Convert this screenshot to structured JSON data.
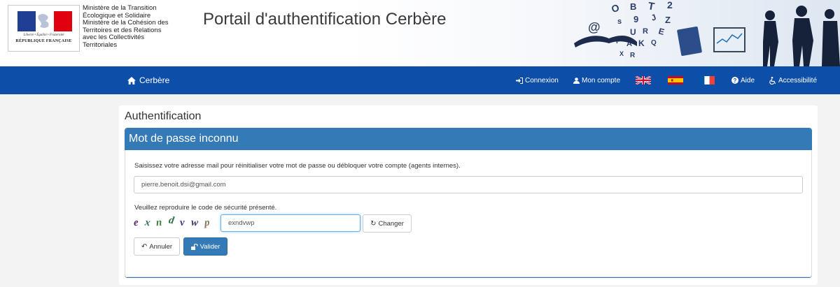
{
  "header": {
    "logo": {
      "motto": "Liberté • Égalité • Fraternité",
      "republic": "RÉPUBLIQUE FRANÇAISE",
      "colors": [
        "#1f3f94",
        "#ffffff",
        "#e1000f"
      ]
    },
    "ministry_lines": [
      "Ministère de la Transition",
      "Écologique et Solidaire",
      "Ministère de la Cohésion des",
      "Territoires et des Relations",
      "avec les Collectivités",
      "Territoriales"
    ],
    "portal_title": "Portail d'authentification Cerbère",
    "deco_letters": "B T 2 s 9 J U R O Z A E N K P Q X @ 8"
  },
  "navbar": {
    "background": "#0d4ea8",
    "brand": {
      "label": "Cerbère",
      "icon": "home-icon"
    },
    "items": [
      {
        "label": "Connexion",
        "icon": "sign-in-icon"
      },
      {
        "label": "Mon compte",
        "icon": "user-icon"
      },
      {
        "label": "Aide",
        "icon": "question-circle-icon"
      },
      {
        "label": "Accessibilité",
        "icon": "wheelchair-icon"
      }
    ],
    "flags": [
      "united-kingdom-flag",
      "spain-flag",
      "france-flag"
    ]
  },
  "main": {
    "card_title": "Authentification",
    "panel_title": "Mot de passe inconnu",
    "panel_color": "#337ab7",
    "email_instruction": "Saisissez votre adresse mail pour réinitialiser votre mot de passe ou débloquer votre compte (agents internes).",
    "email_value": "pierre.benoit.dsi@gmail.com",
    "captcha_instruction": "Veuillez reproduire le code de sécurité présenté.",
    "captcha_chars": [
      {
        "ch": "e",
        "color": "#5a2a6a"
      },
      {
        "ch": "x",
        "color": "#3c6e5a"
      },
      {
        "ch": "n",
        "color": "#3f7f40"
      },
      {
        "ch": "d",
        "color": "#2f6f47"
      },
      {
        "ch": "v",
        "color": "#3d3d8c"
      },
      {
        "ch": "w",
        "color": "#4a3468"
      },
      {
        "ch": "p",
        "color": "#8a7a5a"
      }
    ],
    "captcha_value": "exndvwp",
    "change_button": "Changer",
    "cancel_button": "Annuler",
    "submit_button": "Valider"
  }
}
